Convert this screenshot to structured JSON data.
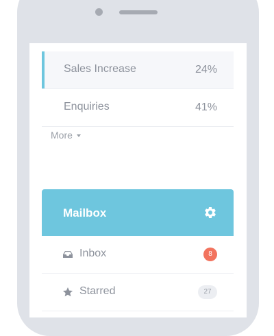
{
  "stats": [
    {
      "label": "Sales Increase",
      "value": "24%",
      "active": true
    },
    {
      "label": "Enquiries",
      "value": "41%",
      "active": false
    }
  ],
  "more": {
    "label": "More"
  },
  "mailbox": {
    "title": "Mailbox",
    "items": [
      {
        "label": "Inbox",
        "badge": "8",
        "icon": "inbox-icon"
      },
      {
        "label": "Starred",
        "badge": "27",
        "icon": "star-icon"
      }
    ]
  },
  "colors": {
    "accent": "#6ec6de",
    "badge_alert": "#f2735e",
    "device_frame": "#dfe2e8"
  }
}
